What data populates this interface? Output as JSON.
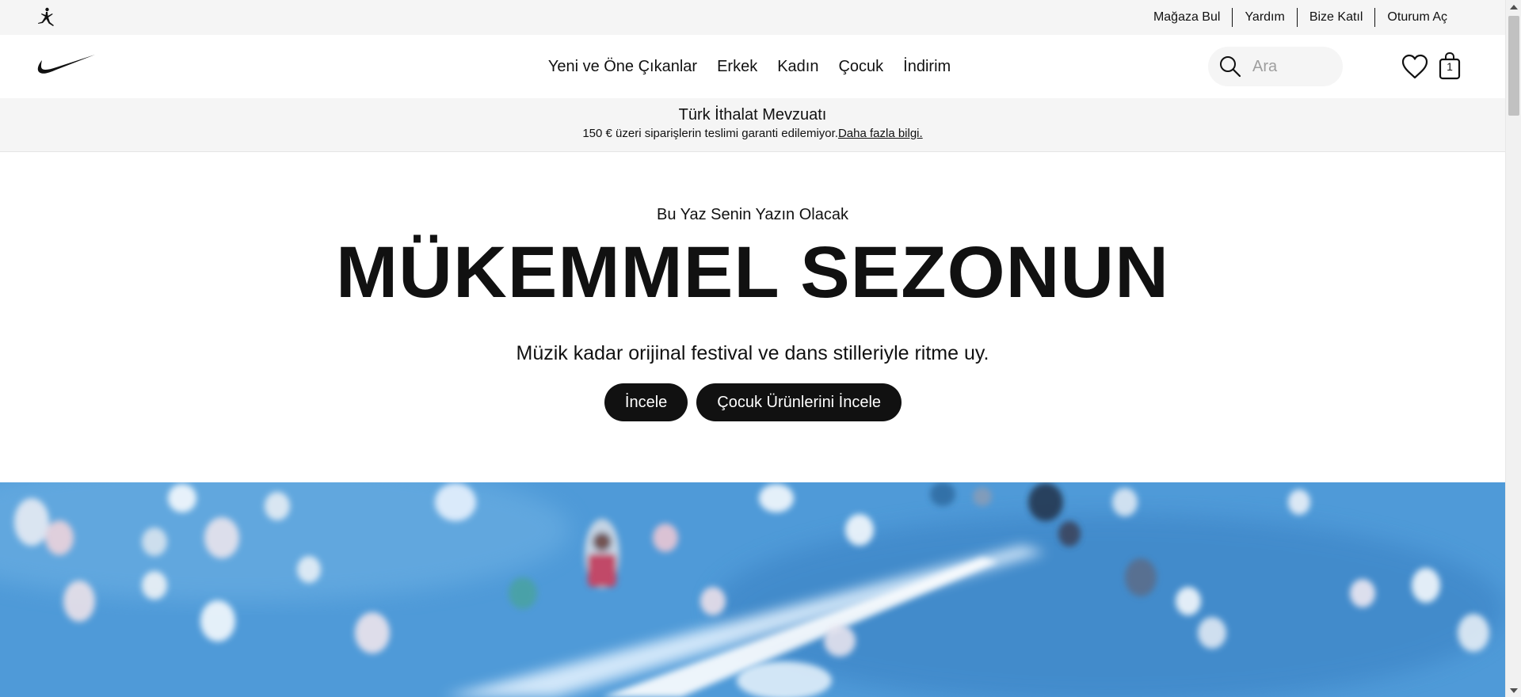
{
  "utility": {
    "links": [
      "Mağaza Bul",
      "Yardım",
      "Bize Katıl",
      "Oturum Aç"
    ]
  },
  "nav": {
    "items": [
      "Yeni ve Öne Çıkanlar",
      "Erkek",
      "Kadın",
      "Çocuk",
      "İndirim"
    ],
    "search_placeholder": "Ara",
    "bag_count": "1"
  },
  "notice": {
    "title": "Türk İthalat Mevzuatı",
    "text": "150 € üzeri siparişlerin teslimi garanti edilemiyor.",
    "link": "Daha fazla bilgi."
  },
  "hero": {
    "kicker": "Bu Yaz Senin Yazın Olacak",
    "title": "MÜKEMMEL SEZONUN",
    "subtitle": "Müzik kadar orijinal festival ve dans stilleriyle ritme uy.",
    "buttons": [
      "İncele",
      "Çocuk Ürünlerini İncele"
    ]
  },
  "icons": {
    "jordan": "jordan-jumpman-icon",
    "brand": "swoosh-logo-icon",
    "search": "search-icon",
    "favorites": "heart-icon",
    "bag": "bag-icon"
  },
  "colors": {
    "text": "#111111",
    "utility_bg": "#f5f5f5",
    "button_bg": "#111111",
    "button_text": "#ffffff"
  }
}
